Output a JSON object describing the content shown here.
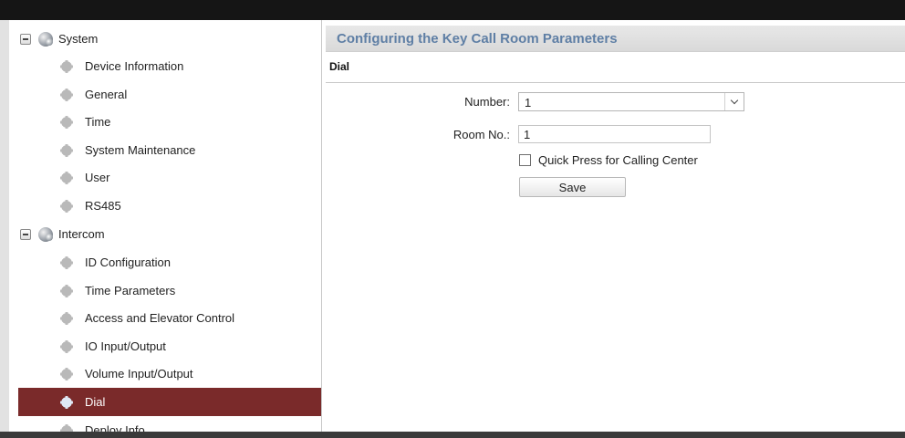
{
  "sidebar": {
    "groups": [
      {
        "label": "System",
        "items": [
          {
            "label": "Device Information"
          },
          {
            "label": "General"
          },
          {
            "label": "Time"
          },
          {
            "label": "System Maintenance"
          },
          {
            "label": "User"
          },
          {
            "label": "RS485"
          }
        ]
      },
      {
        "label": "Intercom",
        "items": [
          {
            "label": "ID Configuration"
          },
          {
            "label": "Time Parameters"
          },
          {
            "label": "Access and Elevator Control"
          },
          {
            "label": "IO Input/Output"
          },
          {
            "label": "Volume Input/Output"
          },
          {
            "label": "Dial"
          },
          {
            "label": "Deploy Info"
          }
        ]
      }
    ],
    "selected_item": "Dial",
    "selected_color": "#7a2a2a"
  },
  "main": {
    "title": "Configuring the Key Call Room Parameters",
    "section": "Dial",
    "number_label": "Number:",
    "number_value": "1",
    "room_label": "Room No.:",
    "room_value": "1",
    "quick_press_label": "Quick Press for Calling Center",
    "quick_press_checked": false,
    "save_label": "Save"
  },
  "colors": {
    "title_text": "#5f7fa5",
    "title_bar": "#dddddd"
  }
}
